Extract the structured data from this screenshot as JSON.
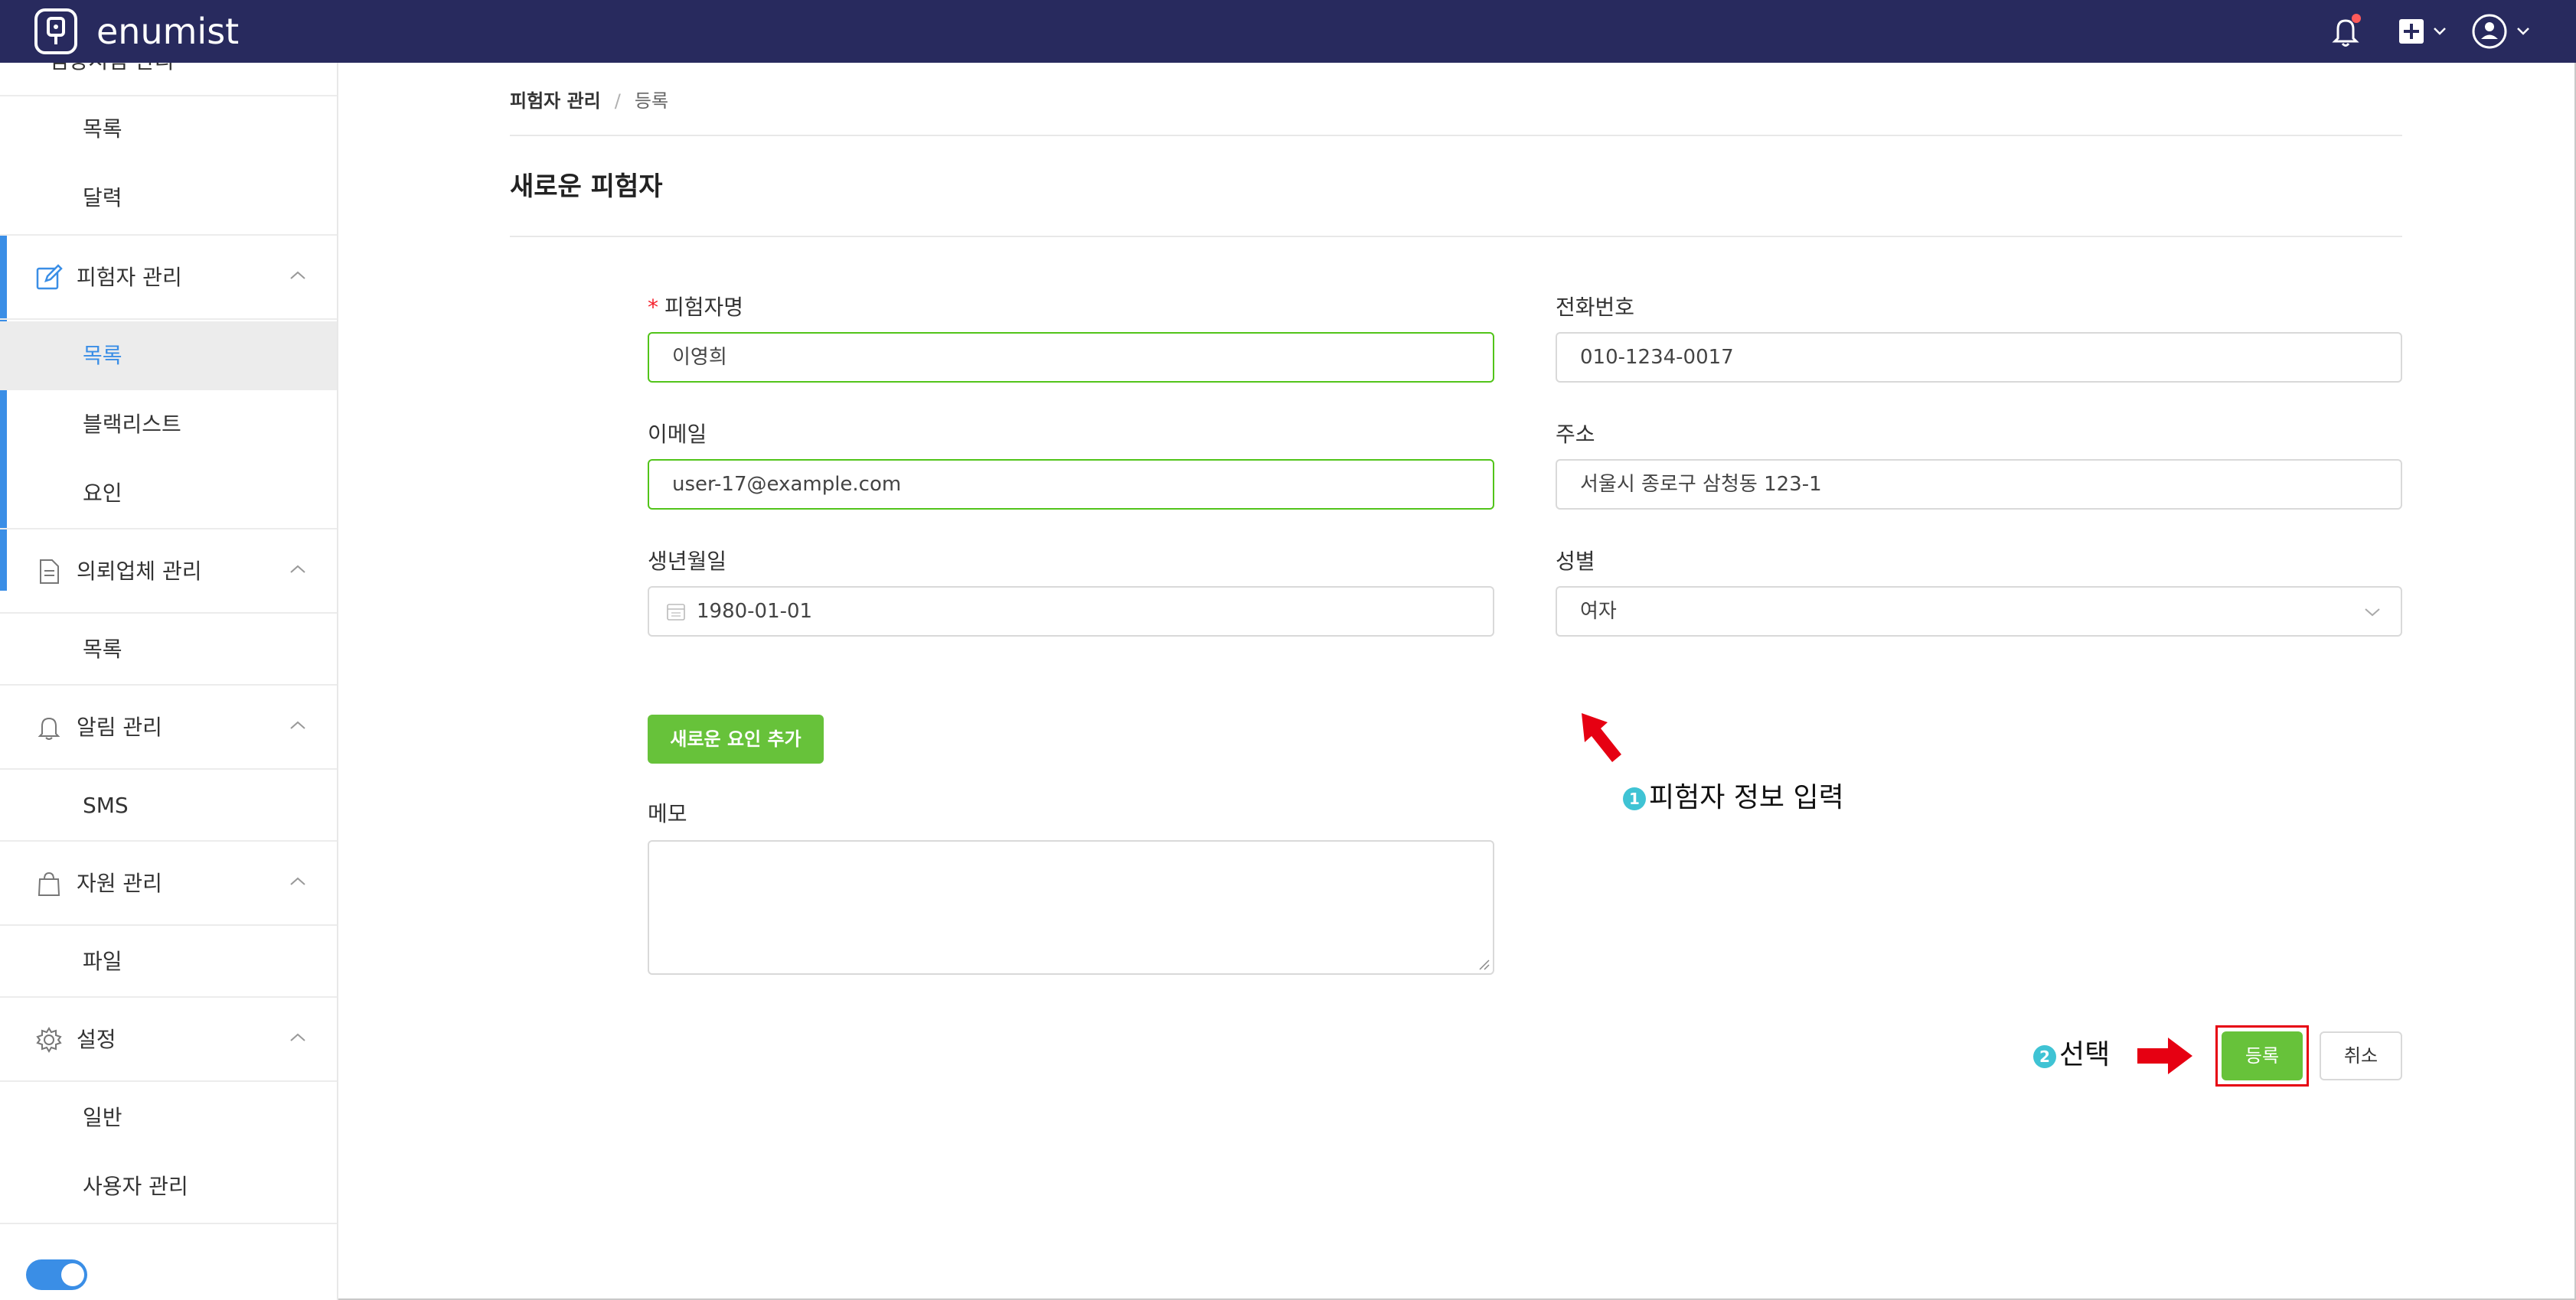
{
  "app": {
    "name": "enumist"
  },
  "header": {
    "notification_icon": "bell-icon",
    "add_icon": "plus-square-icon",
    "user_icon": "user-circle-icon"
  },
  "sidebar": {
    "partial_top_label": "임상시험 관리",
    "top_items": [
      "목록",
      "달력"
    ],
    "groups": [
      {
        "label": "피험자 관리",
        "icon": "edit-icon",
        "items": [
          "목록",
          "블랙리스트",
          "요인"
        ],
        "active_item": "목록"
      },
      {
        "label": "의뢰업체 관리",
        "icon": "document-icon",
        "items": [
          "목록"
        ]
      },
      {
        "label": "알림 관리",
        "icon": "bell-icon",
        "items": [
          "SMS"
        ]
      },
      {
        "label": "자원 관리",
        "icon": "bag-icon",
        "items": [
          "파일"
        ]
      },
      {
        "label": "설정",
        "icon": "gear-icon",
        "items": [
          "일반",
          "사용자 관리"
        ]
      }
    ],
    "toggle_on": true
  },
  "breadcrumb": {
    "parent": "피험자 관리",
    "separator": "/",
    "current": "등록"
  },
  "page": {
    "title": "새로운 피험자"
  },
  "form": {
    "name": {
      "label": "피험자명",
      "required_mark": "*",
      "value": "이영희"
    },
    "phone": {
      "label": "전화번호",
      "value": "010-1234-0017"
    },
    "email": {
      "label": "이메일",
      "value": "user-17@example.com"
    },
    "address": {
      "label": "주소",
      "value": "서울시 종로구 삼청동 123-1"
    },
    "birth": {
      "label": "생년월일",
      "value": "1980-01-01"
    },
    "gender": {
      "label": "성별",
      "value": "여자"
    },
    "add_factor_button": "새로운 요인 추가",
    "memo": {
      "label": "메모",
      "value": ""
    },
    "submit_button": "등록",
    "cancel_button": "취소"
  },
  "annotations": [
    {
      "number": "1",
      "text": "피험자 정보 입력"
    },
    {
      "number": "2",
      "text": "선택"
    }
  ],
  "colors": {
    "topbar": "#282a5e",
    "accent": "#3a8ee6",
    "success": "#67c23a",
    "annotation_arrow": "#e60012",
    "annotation_badge": "#3fc3d4"
  }
}
